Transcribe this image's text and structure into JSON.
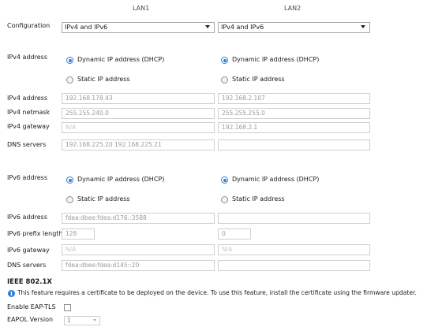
{
  "columns": {
    "lan1": "LAN1",
    "lan2": "LAN2"
  },
  "configuration": {
    "label": "Configuration",
    "lan1_value": "IPv4 and IPv6",
    "lan2_value": "IPv4 and IPv6"
  },
  "ipv4": {
    "mode_label": "IPv4 address",
    "dhcp_label": "Dynamic IP address (DHCP)",
    "static_label": "Static IP address",
    "lan1_selected": "dhcp",
    "lan2_selected": "dhcp",
    "rows": {
      "address": {
        "label": "IPv4 address",
        "lan1": "192.168.178.43",
        "lan2": "192.168.2.107"
      },
      "netmask": {
        "label": "IPv4 netmask",
        "lan1": "255.255.240.0",
        "lan2": "255.255.255.0"
      },
      "gateway": {
        "label": "IPv4 gateway",
        "lan1": "N/A",
        "lan2": "192.168.2.1"
      },
      "dns": {
        "label": "DNS servers",
        "lan1": "192.168.225.20 192.168.225.21",
        "lan2": ""
      }
    }
  },
  "ipv6": {
    "mode_label": "IPv6 address",
    "dhcp_label": "Dynamic IP address (DHCP)",
    "static_label": "Static IP address",
    "lan1_selected": "dhcp",
    "lan2_selected": "dhcp",
    "rows": {
      "address": {
        "label": "IPv6 address",
        "lan1": "fdea:dbee:fdea:d176::3588",
        "lan2": ""
      },
      "prefix": {
        "label": "IPv6 prefix length",
        "lan1": "128",
        "lan2": "0"
      },
      "gateway": {
        "label": "IPv6 gateway",
        "lan1": "N/A",
        "lan2": "N/A"
      },
      "dns": {
        "label": "DNS servers",
        "lan1": "fdea:dbee:fdea:d145::20",
        "lan2": ""
      }
    }
  },
  "ieee": {
    "title": "IEEE 802.1X",
    "info_icon": "info-icon",
    "info_text": "This feature requires a certificate to be deployed on the device. To use this feature, install the certificate using the firmware updater.",
    "eap_tls_label": "Enable EAP-TLS",
    "eap_tls_checked": false,
    "eapol_label": "EAPOL Version",
    "eapol_value": "1"
  },
  "colors": {
    "accent": "#2f7dd6",
    "field_border": "#cfcfcf",
    "disabled_text": "#9a9a9a"
  }
}
